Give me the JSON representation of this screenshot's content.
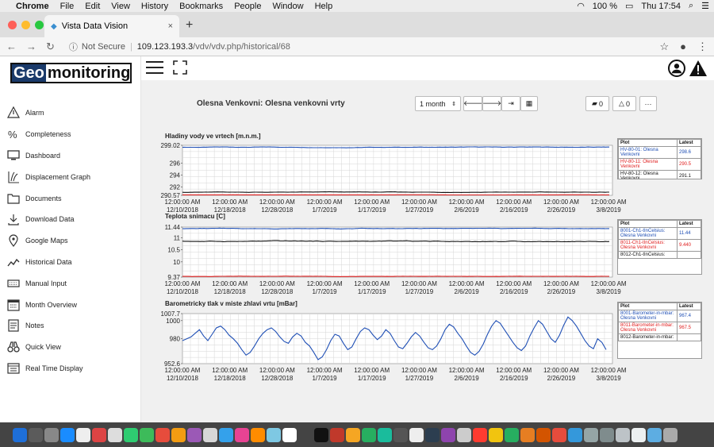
{
  "menubar": {
    "app": "Chrome",
    "items": [
      "File",
      "Edit",
      "View",
      "History",
      "Bookmarks",
      "People",
      "Window",
      "Help"
    ],
    "battery": "100 %",
    "clock": "Thu 17:54"
  },
  "browser": {
    "tab_title": "Vista Data Vision",
    "security": "Not Secure",
    "url_host": "109.123.193.3",
    "url_path": "/vdv/vdv.php/historical/68"
  },
  "logo": {
    "part1": "Geo",
    "part2": "monitoring"
  },
  "sidebar": {
    "items": [
      {
        "label": "Alarm",
        "icon": "alarm-icon"
      },
      {
        "label": "Completeness",
        "icon": "percent-icon"
      },
      {
        "label": "Dashboard",
        "icon": "monitor-icon"
      },
      {
        "label": "Displacement Graph",
        "icon": "displacement-icon"
      },
      {
        "label": "Documents",
        "icon": "folder-icon"
      },
      {
        "label": "Download Data",
        "icon": "download-icon"
      },
      {
        "label": "Google Maps",
        "icon": "map-pin-icon"
      },
      {
        "label": "Historical Data",
        "icon": "line-chart-icon"
      },
      {
        "label": "Manual Input",
        "icon": "keyboard-icon"
      },
      {
        "label": "Month Overview",
        "icon": "calendar-icon"
      },
      {
        "label": "Notes",
        "icon": "notes-icon"
      },
      {
        "label": "Quick View",
        "icon": "binoculars-icon"
      },
      {
        "label": "Real Time Display",
        "icon": "display-icon"
      }
    ]
  },
  "page": {
    "title": "Olesna Venkovni: Olesna venkovni vrty",
    "period": "1 month",
    "comments": "0",
    "alarms": "0",
    "more": "···"
  },
  "x_ticks": [
    {
      "time": "12:00:00 AM",
      "date": "12/10/2018"
    },
    {
      "time": "12:00:00 AM",
      "date": "12/18/2018"
    },
    {
      "time": "12:00:00 AM",
      "date": "12/28/2018"
    },
    {
      "time": "12:00:00 AM",
      "date": "1/7/2019"
    },
    {
      "time": "12:00:00 AM",
      "date": "1/17/2019"
    },
    {
      "time": "12:00:00 AM",
      "date": "1/27/2019"
    },
    {
      "time": "12:00:00 AM",
      "date": "2/6/2019"
    },
    {
      "time": "12:00:00 AM",
      "date": "2/16/2019"
    },
    {
      "time": "12:00:00 AM",
      "date": "2/26/2019"
    },
    {
      "time": "12:00:00 AM",
      "date": "3/8/2019"
    }
  ],
  "chart_data": [
    {
      "type": "line",
      "title": "Hladiny vody ve vrtech [m.n.m.]",
      "ylim": [
        290.57,
        299.02
      ],
      "yticks": [
        "299.02",
        "296",
        "294",
        "292",
        "290.57"
      ],
      "legend_header": [
        "Plot",
        "Latest"
      ],
      "series": [
        {
          "name": "HV-80-01: Olesna Venkovni",
          "latest": "298.6",
          "color": "#1f4fb5",
          "level": 298.7,
          "noise": 0.08
        },
        {
          "name": "HV-80-11: Olesna Venkovni",
          "latest": "290.5",
          "color": "#e02020",
          "level": 290.65,
          "noise": 0.02
        },
        {
          "name": "HV-80-12: Olesna Venkovni",
          "latest": "291.1",
          "color": "#111111",
          "level": 291.1,
          "noise": 0.06
        }
      ]
    },
    {
      "type": "line",
      "title": "Teplota snimacu [C]",
      "ylim": [
        9.37,
        11.44
      ],
      "yticks": [
        "11.44",
        "11",
        "10.5",
        "10",
        "9.37"
      ],
      "legend_header": [
        "Plot",
        "Latest"
      ],
      "series": [
        {
          "name": "8001-Ch1-tInCelsius: Olesna Venkovni",
          "latest": "11.44",
          "color": "#1f4fb5",
          "level": 11.38,
          "noise": 0.02
        },
        {
          "name": "8011-Ch1-tInCelsius: Olesna Venkovni",
          "latest": "9.440",
          "color": "#e02020",
          "level": 9.4,
          "noise": 0.01
        },
        {
          "name": "8012-Ch1-tInCelsius:",
          "latest": "",
          "color": "#111111",
          "level": 10.85,
          "noise": 0.03
        }
      ]
    },
    {
      "type": "line",
      "title": "Barometricky tlak v miste zhlavi vrtu [mBar]",
      "ylim": [
        952.6,
        1007.7
      ],
      "yticks": [
        "1007.7",
        "1000",
        "980",
        "952.6"
      ],
      "legend_header": [
        "Plot",
        "Latest"
      ],
      "series": [
        {
          "name": "8001-Barometer-in-mbar: Olesna Venkovni",
          "latest": "967.4",
          "color": "#1f4fb5"
        },
        {
          "name": "8011-Barometer-in-mbar: Olesna Venkovni",
          "latest": "967.5",
          "color": "#e02020"
        },
        {
          "name": "8012-Barometer-in-mbar:",
          "latest": "",
          "color": "#111111"
        }
      ],
      "values": [
        978,
        980,
        982,
        986,
        990,
        983,
        978,
        985,
        992,
        994,
        990,
        984,
        980,
        975,
        968,
        962,
        965,
        972,
        980,
        986,
        990,
        992,
        988,
        982,
        977,
        975,
        982,
        986,
        983,
        976,
        972,
        965,
        957,
        960,
        968,
        978,
        985,
        983,
        975,
        968,
        971,
        980,
        988,
        992,
        990,
        984,
        979,
        983,
        990,
        986,
        978,
        971,
        969,
        975,
        982,
        987,
        983,
        976,
        970,
        968,
        972,
        980,
        990,
        996,
        993,
        986,
        980,
        972,
        965,
        962,
        966,
        974,
        985,
        994,
        1000,
        997,
        990,
        983,
        976,
        970,
        967,
        972,
        983,
        992,
        1000,
        996,
        988,
        980,
        976,
        984,
        995,
        1004,
        1000,
        994,
        986,
        978,
        972,
        969,
        980,
        976,
        968
      ]
    }
  ]
}
